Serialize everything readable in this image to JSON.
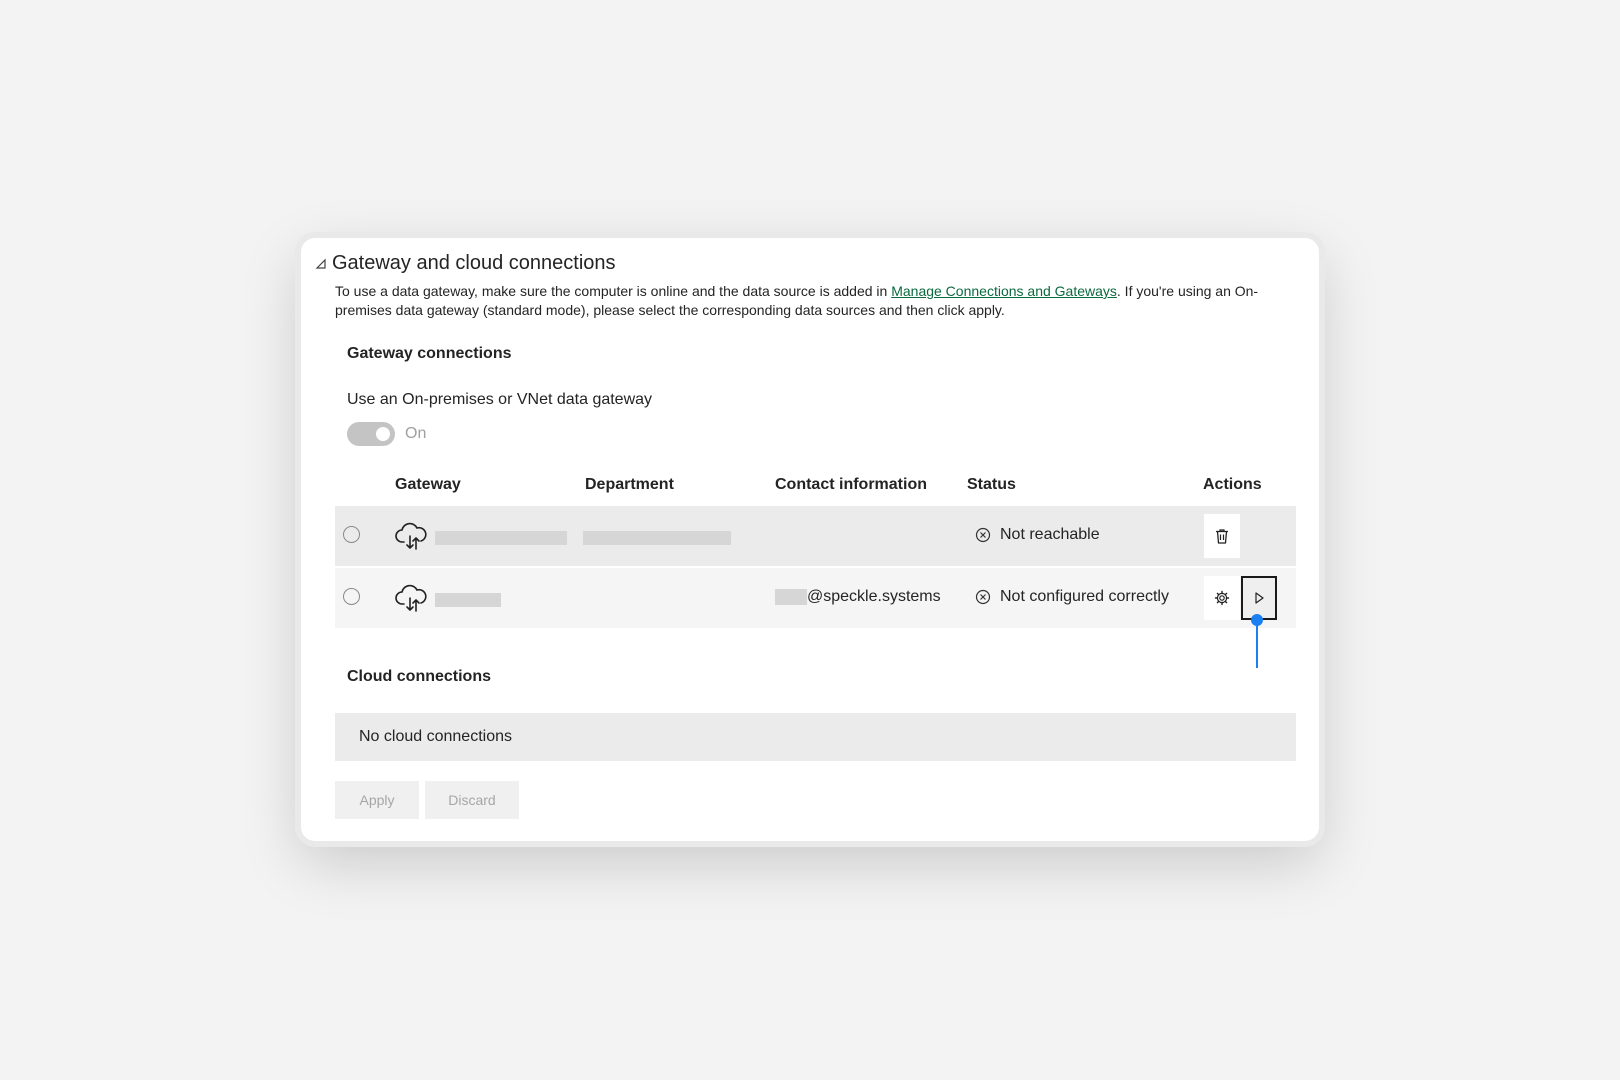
{
  "panel": {
    "title": "Gateway and cloud connections",
    "description_before_link": "To use a data gateway, make sure the computer is online and the data source is added in ",
    "description_link": "Manage Connections and Gateways",
    "description_after_link": ". If you're using an On-premises data gateway (standard mode), please select the corresponding data sources and then click apply."
  },
  "gateway_section": {
    "heading": "Gateway connections",
    "toggle_label": "Use an On-premises or VNet data gateway",
    "toggle_state": "On",
    "columns": [
      "Gateway",
      "Department",
      "Contact information",
      "Status",
      "Actions"
    ],
    "rows": [
      {
        "gateway": "",
        "department": "",
        "contact": "",
        "status": "Not reachable",
        "actions": [
          "trash-icon"
        ]
      },
      {
        "gateway": "",
        "department": "",
        "contact": "@speckle.systems",
        "status": "Not configured correctly",
        "actions": [
          "gear-icon",
          "play-icon"
        ]
      }
    ]
  },
  "cloud_section": {
    "heading": "Cloud connections",
    "empty_text": "No cloud connections"
  },
  "footer": {
    "apply_label": "Apply",
    "discard_label": "Discard"
  },
  "colors": {
    "link": "#0b6a3e",
    "cursor": "#1a7ff0",
    "row_selected": "#ebebeb"
  }
}
